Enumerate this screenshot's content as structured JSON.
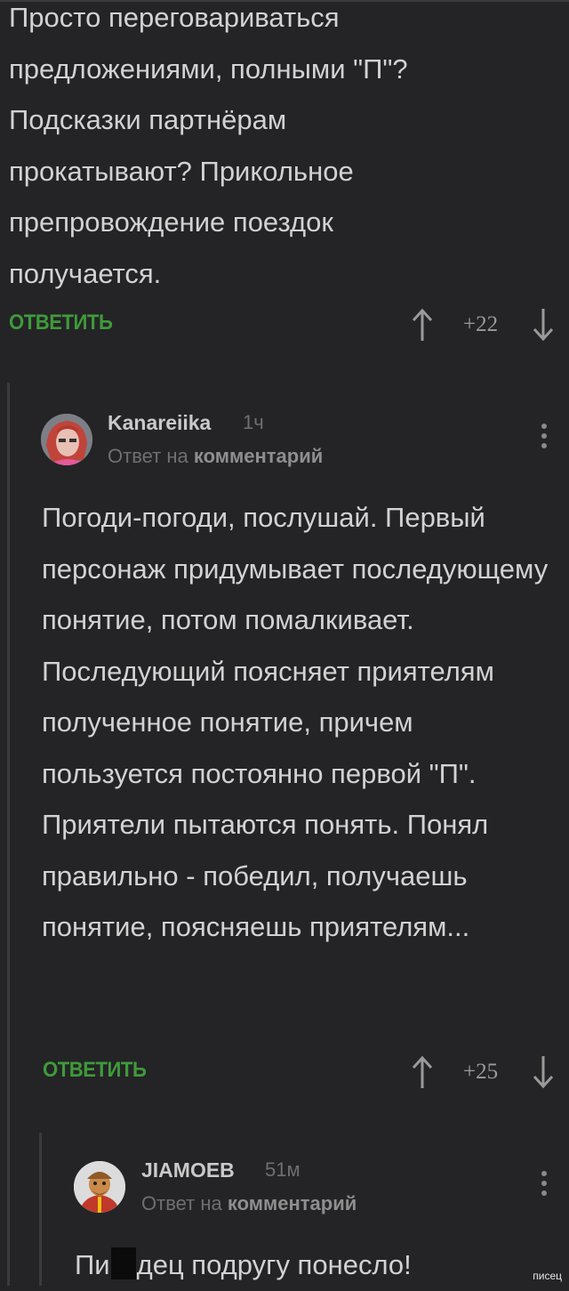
{
  "comment1": {
    "text": "Просто переговариваться предложениями, полными \"П\"? Подсказки партнёрам прокатывают? Прикольное препровождение поездок получается.",
    "reply_label": "ОТВЕТИТЬ",
    "score": "+22"
  },
  "comment2": {
    "author": "Kanareiika",
    "time": "1ч",
    "reply_to_prefix": "Ответ на",
    "reply_to_target": "комментарий",
    "text": "Погоди-погоди, послушай. Первый персонаж придумывает последующему понятие, потом помалкивает. Последующий поясняет приятелям полученное понятие, причем пользуется постоянно первой \"П\". Приятели пытаются понять. Понял правильно - победил, получаешь понятие, поясняешь приятелям...",
    "reply_label": "ОТВЕТИТЬ",
    "score": "+25"
  },
  "comment3": {
    "author": "JIAMOEB",
    "time": "51м",
    "reply_to_prefix": "Ответ на",
    "reply_to_target": "комментарий",
    "text_start": "Пи",
    "text_end": "дец подругу понесло!"
  },
  "watermark": "писец",
  "colors": {
    "background": "#242426",
    "accent_green": "#3f9a3a",
    "text": "#d2d2d2",
    "muted": "#6f6f6f"
  },
  "icons": [
    "upvote-arrow-icon",
    "downvote-arrow-icon",
    "more-vertical-icon",
    "avatar"
  ]
}
